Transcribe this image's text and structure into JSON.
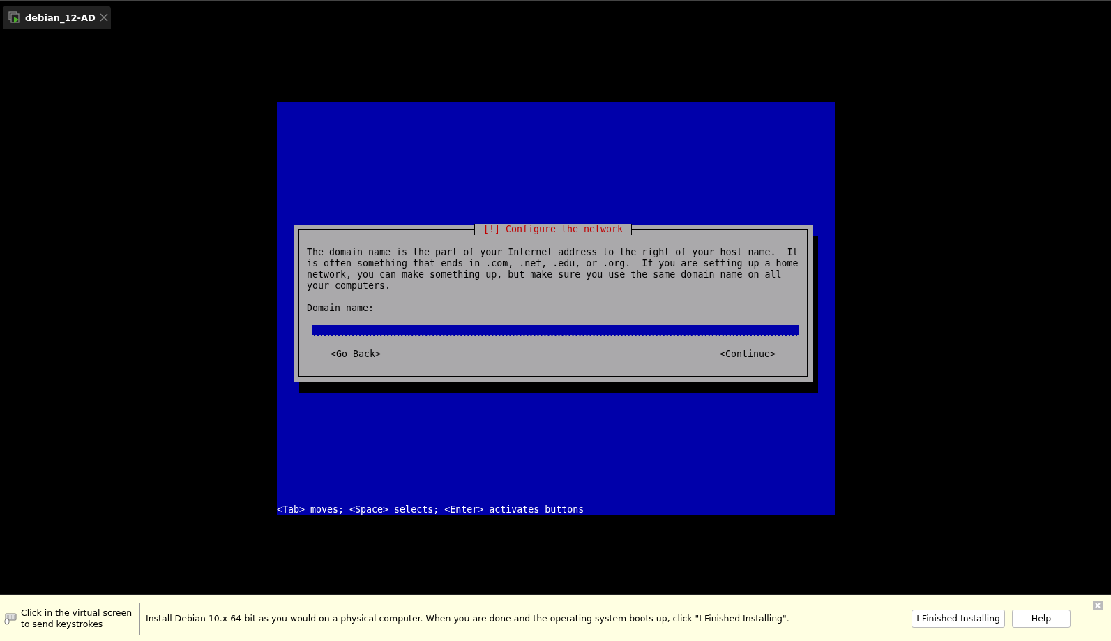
{
  "tab": {
    "title": "debian_12-AD",
    "selected": true
  },
  "installer": {
    "dialog_title": "[!] Configure the network",
    "description": "The domain name is the part of your Internet address to the right of your host name.  It\nis often something that ends in .com, .net, .edu, or .org.  If you are setting up a home\nnetwork, you can make something up, but make sure you use the same domain name on all\nyour computers.",
    "field_label": "Domain name:",
    "buttons": [
      "<Go Back>",
      "<Continue>"
    ],
    "hint": "<Tab> moves; <Space> selects; <Enter> activates buttons"
  },
  "status_bar": {
    "keyboard_hint": "Click in the virtual screen to send keystrokes",
    "message": "Install Debian 10.x 64-bit as you would on a physical computer. When you are done and the operating system boots up, click \"I Finished Installing\".",
    "buttons": [
      "I Finished Installing",
      "Help"
    ]
  }
}
